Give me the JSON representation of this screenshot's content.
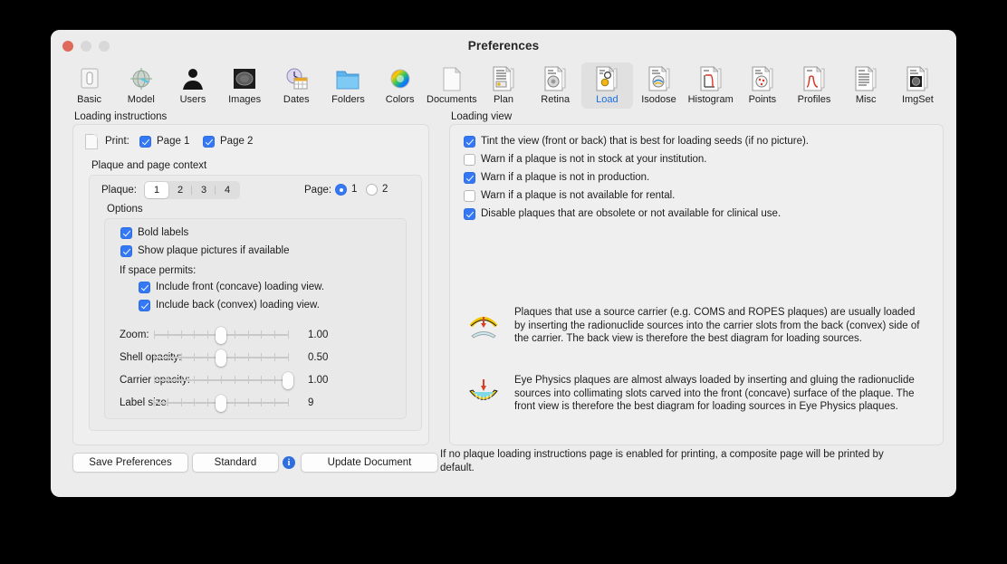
{
  "window": {
    "title": "Preferences",
    "traffic": [
      "close",
      "minimize",
      "maximize"
    ]
  },
  "toolbar": {
    "selected": "Load",
    "items": [
      {
        "label": "Basic",
        "icon": "basic-switch-icon"
      },
      {
        "label": "Model",
        "icon": "model-globe-icon"
      },
      {
        "label": "Users",
        "icon": "users-person-icon"
      },
      {
        "label": "Images",
        "icon": "images-photo-icon"
      },
      {
        "label": "Dates",
        "icon": "dates-calendar-clock-icon"
      },
      {
        "label": "Folders",
        "icon": "folders-folder-icon"
      },
      {
        "label": "Colors",
        "icon": "colors-wheel-icon"
      },
      {
        "label": "Documents",
        "icon": "documents-page-icon"
      },
      {
        "label": "Plan",
        "icon": "plan-document-icon"
      },
      {
        "label": "Retina",
        "icon": "retina-document-icon"
      },
      {
        "label": "Load",
        "icon": "load-document-icon"
      },
      {
        "label": "Isodose",
        "icon": "isodose-document-icon"
      },
      {
        "label": "Histogram",
        "icon": "histogram-document-icon"
      },
      {
        "label": "Points",
        "icon": "points-document-icon"
      },
      {
        "label": "Profiles",
        "icon": "profiles-document-icon"
      },
      {
        "label": "Misc",
        "icon": "misc-document-icon"
      },
      {
        "label": "ImgSet",
        "icon": "imgset-document-icon"
      }
    ]
  },
  "left": {
    "group_label": "Loading instructions",
    "print_label": "Print:",
    "print_pages": [
      {
        "label": "Page 1",
        "checked": true
      },
      {
        "label": "Page 2",
        "checked": true
      }
    ],
    "context_label": "Plaque and page context",
    "plaque_label": "Plaque:",
    "plaque_options": [
      "1",
      "2",
      "3",
      "4"
    ],
    "plaque_selected": "1",
    "page_label": "Page:",
    "page_options": [
      "1",
      "2"
    ],
    "page_selected": "1",
    "options_label": "Options",
    "options": [
      {
        "label": "Bold labels",
        "checked": true
      },
      {
        "label": "Show plaque pictures if available",
        "checked": true
      }
    ],
    "space_permits_label": "If space permits:",
    "space_options": [
      {
        "label": "Include front (concave) loading view.",
        "checked": true
      },
      {
        "label": "Include back (convex) loading view.",
        "checked": true
      }
    ],
    "sliders": [
      {
        "label": "Zoom:",
        "value": "1.00",
        "pos": 50
      },
      {
        "label": "Shell opacity:",
        "value": "0.50",
        "pos": 50
      },
      {
        "label": "Carrier opacity:",
        "value": "1.00",
        "pos": 100
      },
      {
        "label": "Label size:",
        "value": "9",
        "pos": 50
      }
    ]
  },
  "right": {
    "group_label": "Loading view",
    "checks": [
      {
        "label": "Tint the view (front or back) that is best for loading seeds (if no picture).",
        "checked": true
      },
      {
        "label": "Warn if a plaque is not in stock at your institution.",
        "checked": false
      },
      {
        "label": "Warn if a plaque is not in production.",
        "checked": true
      },
      {
        "label": "Warn if a plaque is not available for rental.",
        "checked": false
      },
      {
        "label": "Disable plaques that are obsolete or not available for clinical use.",
        "checked": true
      }
    ],
    "info": [
      {
        "icon": "convex-carrier-back-icon",
        "text": "Plaques that use a source carrier (e.g. COMS and ROPES plaques) are usually loaded by inserting the radionuclide sources into the carrier slots from the back (convex) side of the carrier. The back view is therefore the best diagram for loading sources."
      },
      {
        "icon": "concave-plaque-front-icon",
        "text": "Eye Physics plaques are almost always loaded by inserting and gluing the radionuclide sources into collimating slots carved into the front (concave) surface of the plaque. The front view is therefore the best diagram for loading sources in Eye Physics plaques."
      }
    ]
  },
  "bottom": {
    "save_label": "Save Preferences",
    "standard_label": "Standard",
    "info_label": "i",
    "update_label": "Update Document",
    "footer_text": "If no plaque loading instructions page is enabled for printing, a composite page will be printed by default."
  },
  "colors": {
    "accent": "#3478f6",
    "selected_tab": "#1a6fe0",
    "window_bg": "#ececec",
    "group_bg": "#efefef"
  }
}
